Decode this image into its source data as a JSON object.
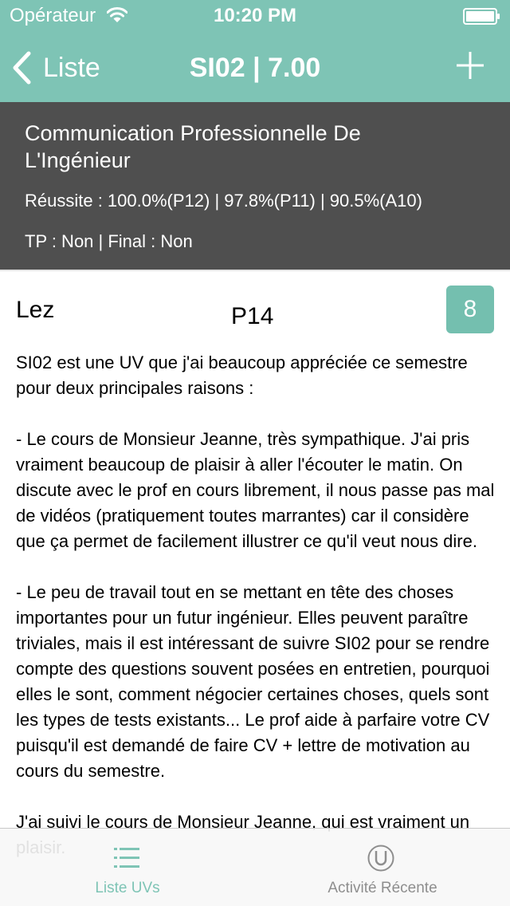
{
  "status_bar": {
    "carrier": "Opérateur",
    "time": "10:20 PM"
  },
  "nav": {
    "back_label": "Liste",
    "title": "SI02 | 7.00"
  },
  "uv": {
    "name": "Communication Professionnelle De L'Ingénieur",
    "success": "Réussite : 100.0%(P12) | 97.8%(P11) | 90.5%(A10)",
    "tp_final": "TP : Non | Final : Non"
  },
  "comment": {
    "author": "Lez",
    "semester": "P14",
    "rating": "8",
    "text": "SI02 est une UV que j'ai beaucoup appréciée ce semestre pour deux principales raisons :\n\n- Le cours de Monsieur Jeanne, très sympathique. J'ai pris vraiment beaucoup de plaisir à aller l'écouter le matin. On discute avec le prof en cours librement, il nous passe pas mal de vidéos (pratiquement toutes marrantes) car il considère que ça permet de facilement illustrer ce qu'il veut nous dire.\n\n- Le peu de travail tout en se mettant en tête des choses importantes pour un futur ingénieur. Elles peuvent paraître triviales, mais il est intéressant de suivre SI02 pour se rendre compte des questions souvent posées en entretien, pourquoi elles le sont, comment négocier certaines choses, quels sont les types de tests existants... Le prof aide à parfaire votre CV puisqu'il est demandé de faire CV + lettre de motivation au cours du semestre.\n\nJ'ai suivi le cours de Monsieur Jeanne, qui est vraiment un plaisir."
  },
  "tabs": [
    {
      "label": "Liste UVs",
      "icon": "list-icon",
      "active": true
    },
    {
      "label": "Activité Récente",
      "icon": "u-circle-icon",
      "active": false
    }
  ],
  "colors": {
    "accent": "#7ec4b5",
    "header_dark": "#4f4f4f",
    "badge": "#74bfaf",
    "inactive_tab": "#8e8e8e"
  }
}
